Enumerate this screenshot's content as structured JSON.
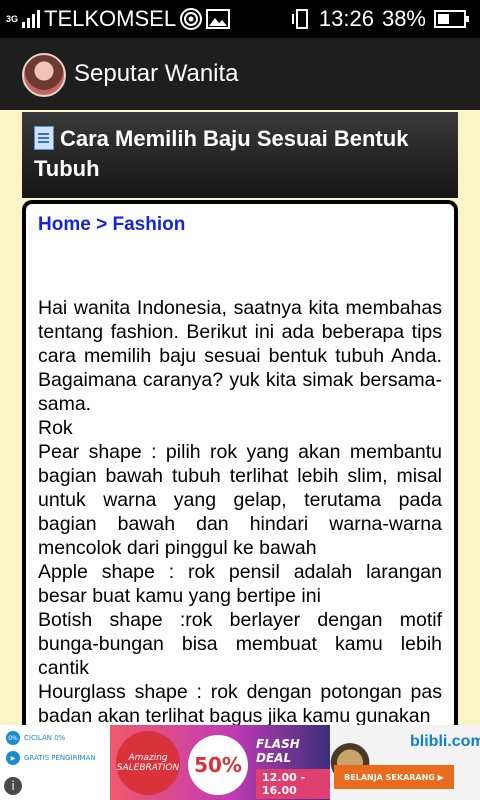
{
  "status_bar": {
    "carrier": "TELKOMSEL",
    "network": "3G",
    "time": "13:26",
    "battery": "38%"
  },
  "app_bar": {
    "title": "Seputar Wanita"
  },
  "post": {
    "title": "Cara Memilih Baju Sesuai Bentuk Tubuh",
    "breadcrumb": {
      "home": "Home",
      "separator": ">",
      "category": "Fashion"
    },
    "paragraphs": [
      "Hai wanita Indonesia, saatnya kita membahas tentang fashion. Berikut ini ada beberapa tips cara memilih baju sesuai bentuk tubuh Anda. Bagaimana caranya? yuk kita simak bersama-sama.",
      "Rok",
      "Pear shape : pilih rok yang akan membantu bagian bawah tubuh terlihat lebih slim, misal untuk warna yang gelap, terutama pada bagian bawah dan hindari warna-warna mencolok dari pinggul ke bawah",
      "Apple shape : rok pensil adalah larangan besar buat kamu yang bertipe ini",
      "Botish shape :rok berlayer dengan motif bunga-bungan bisa membuat kamu lebih cantik",
      "Hourglass shape : rok dengan potongan pas badan akan terlihat bagus jika kamu gunakan"
    ]
  },
  "ad": {
    "cicilan": "CICILAN 0%",
    "gratis": "GRATIS PENGIRIMAN",
    "amazing": "Amazing SALEBRATION",
    "discount": "50%",
    "flash": "FLASH DEAL",
    "time_range": "12.00 - 16.00",
    "brand": "blibli.com",
    "cta": "BELANJA SEKARANG"
  }
}
